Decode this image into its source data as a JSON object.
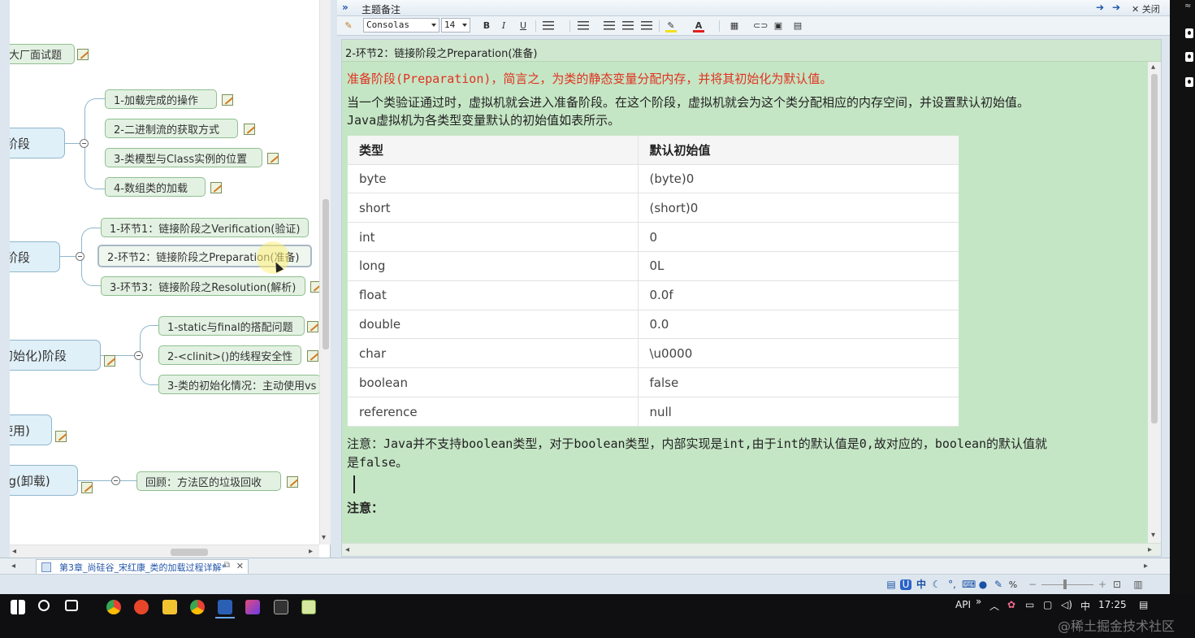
{
  "mindmap": {
    "partial_nodes": [
      {
        "label": "大厂面试题"
      },
      {
        "label": ")阶段"
      },
      {
        "label": ")阶段"
      },
      {
        "label": "初始化)阶段"
      },
      {
        "label": "使用)"
      },
      {
        "label": "ng(卸载)"
      }
    ],
    "loading_children": [
      {
        "label": "1-加载完成的操作"
      },
      {
        "label": "2-二进制流的获取方式"
      },
      {
        "label": "3-类模型与Class实例的位置"
      },
      {
        "label": "4-数组类的加载"
      }
    ],
    "linking_children": [
      {
        "label": "1-环节1：链接阶段之Verification(验证)"
      },
      {
        "label": "2-环节2：链接阶段之Preparation(准备)"
      },
      {
        "label": "3-环节3：链接阶段之Resolution(解析)"
      }
    ],
    "init_children": [
      {
        "label": "1-static与final的搭配问题"
      },
      {
        "label": "2-<clinit>()的线程安全性"
      },
      {
        "label": "3-类的初始化情况：主动使用vs"
      }
    ],
    "unload_children": [
      {
        "label": "回顾：方法区的垃圾回收"
      }
    ]
  },
  "doc_tab": {
    "label": "第3章_尚硅谷_宋红康_类的加载过程详解*"
  },
  "notes_header": {
    "title": "主题备注",
    "close_label": "关闭"
  },
  "toolbar": {
    "font_family": "Consolas",
    "font_size": "14",
    "bold": "B",
    "italic": "I",
    "underline": "U"
  },
  "notes": {
    "topic_title": "2-环节2：链接阶段之Preparation(准备)",
    "highlight": "准备阶段(Preparation)，简言之，为类的静态变量分配内存，并将其初始化为默认值。",
    "para_1": "当一个类验证通过时，虚拟机就会进入准备阶段。在这个阶段，虚拟机就会为这个类分配相应的内存空间，并设置默认初始值。",
    "para_2": "Java虚拟机为各类型变量默认的初始值如表所示。",
    "table": {
      "headers": [
        "类型",
        "默认初始值"
      ],
      "rows": [
        [
          "byte",
          "(byte)0"
        ],
        [
          "short",
          "(short)0"
        ],
        [
          "int",
          "0"
        ],
        [
          "long",
          "0L"
        ],
        [
          "float",
          "0.0f"
        ],
        [
          "double",
          "0.0"
        ],
        [
          "char",
          "\\u0000"
        ],
        [
          "boolean",
          "false"
        ],
        [
          "reference",
          "null"
        ]
      ]
    },
    "note_1": "注意：Java并不支持boolean类型，对于boolean类型，内部实现是int,由于int的默认值是0,故对应的，boolean的默认值就",
    "note_2": "是false。",
    "note_3": "注意："
  },
  "status_bar": {
    "percent": "%",
    "ime_label": "中"
  },
  "taskbar": {
    "tray_api": "API",
    "tray_lang": "中",
    "clock": "17:25"
  },
  "watermark": "@稀土掘金技术社区",
  "colors": {
    "notes_bg": "#c5e6c5",
    "highlight_text": "#e0321f",
    "node_fill": "#e3f1e3"
  }
}
